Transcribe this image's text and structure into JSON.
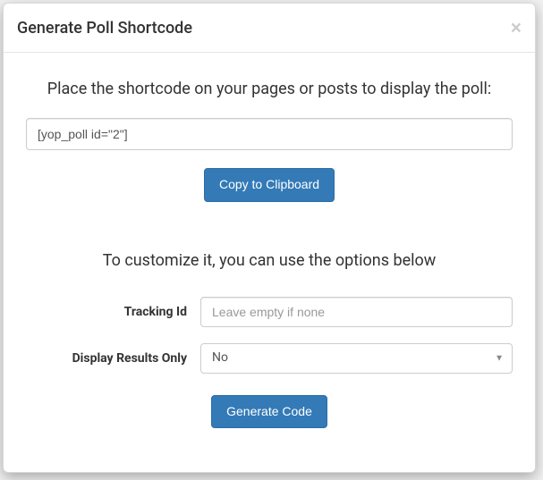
{
  "modal": {
    "title": "Generate Poll Shortcode",
    "close_label": "×"
  },
  "instruction": "Place the shortcode on your pages or posts to display the poll:",
  "shortcode": {
    "value": "[yop_poll id=\"2\"]"
  },
  "buttons": {
    "copy": "Copy to Clipboard",
    "generate": "Generate Code"
  },
  "customize_text": "To customize it, you can use the options below",
  "form": {
    "tracking_label": "Tracking Id",
    "tracking_placeholder": "Leave empty if none",
    "tracking_value": "",
    "display_results_label": "Display Results Only",
    "display_results_value": "No"
  }
}
